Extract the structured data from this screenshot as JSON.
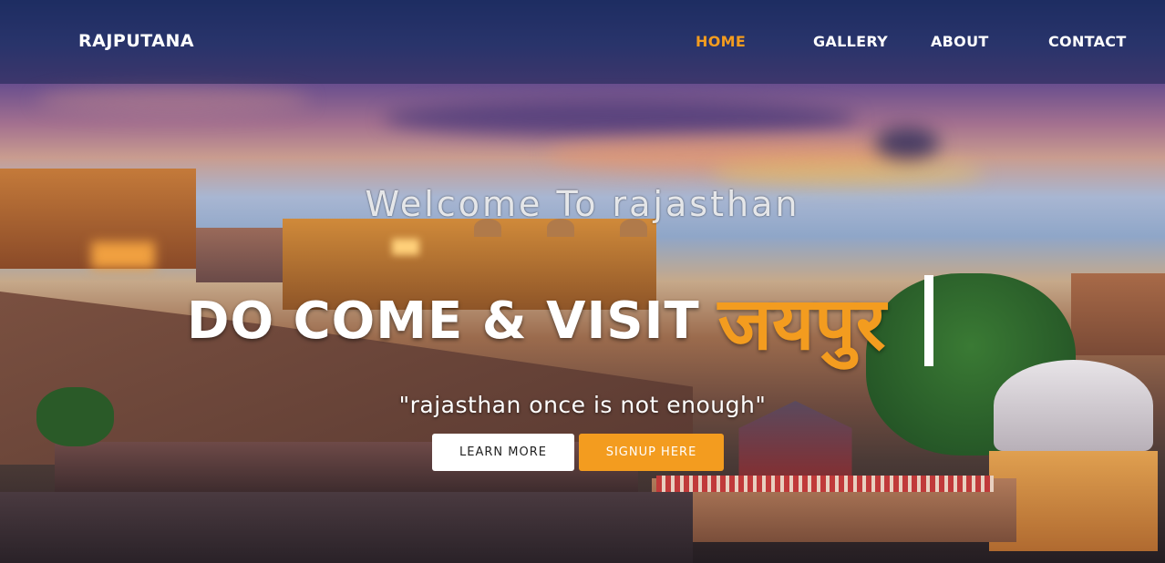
{
  "nav": {
    "brand": "RAJPUTANA",
    "links": [
      {
        "label": "HOME",
        "active": true
      },
      {
        "label": "GALLERY",
        "active": false
      },
      {
        "label": "ABOUT",
        "active": false
      },
      {
        "label": "CONTACT",
        "active": false
      }
    ]
  },
  "hero": {
    "welcome": "Welcome To rajasthan",
    "headline_static": "DO COME & VISIT",
    "headline_typed": "जयपुर",
    "tagline": "\"rajasthan once is not enough\"",
    "learn_more_label": "LEARN MORE",
    "signup_label": "SIGNUP HERE"
  },
  "colors": {
    "accent": "#f39c1f",
    "nav_text": "#ffffff"
  }
}
